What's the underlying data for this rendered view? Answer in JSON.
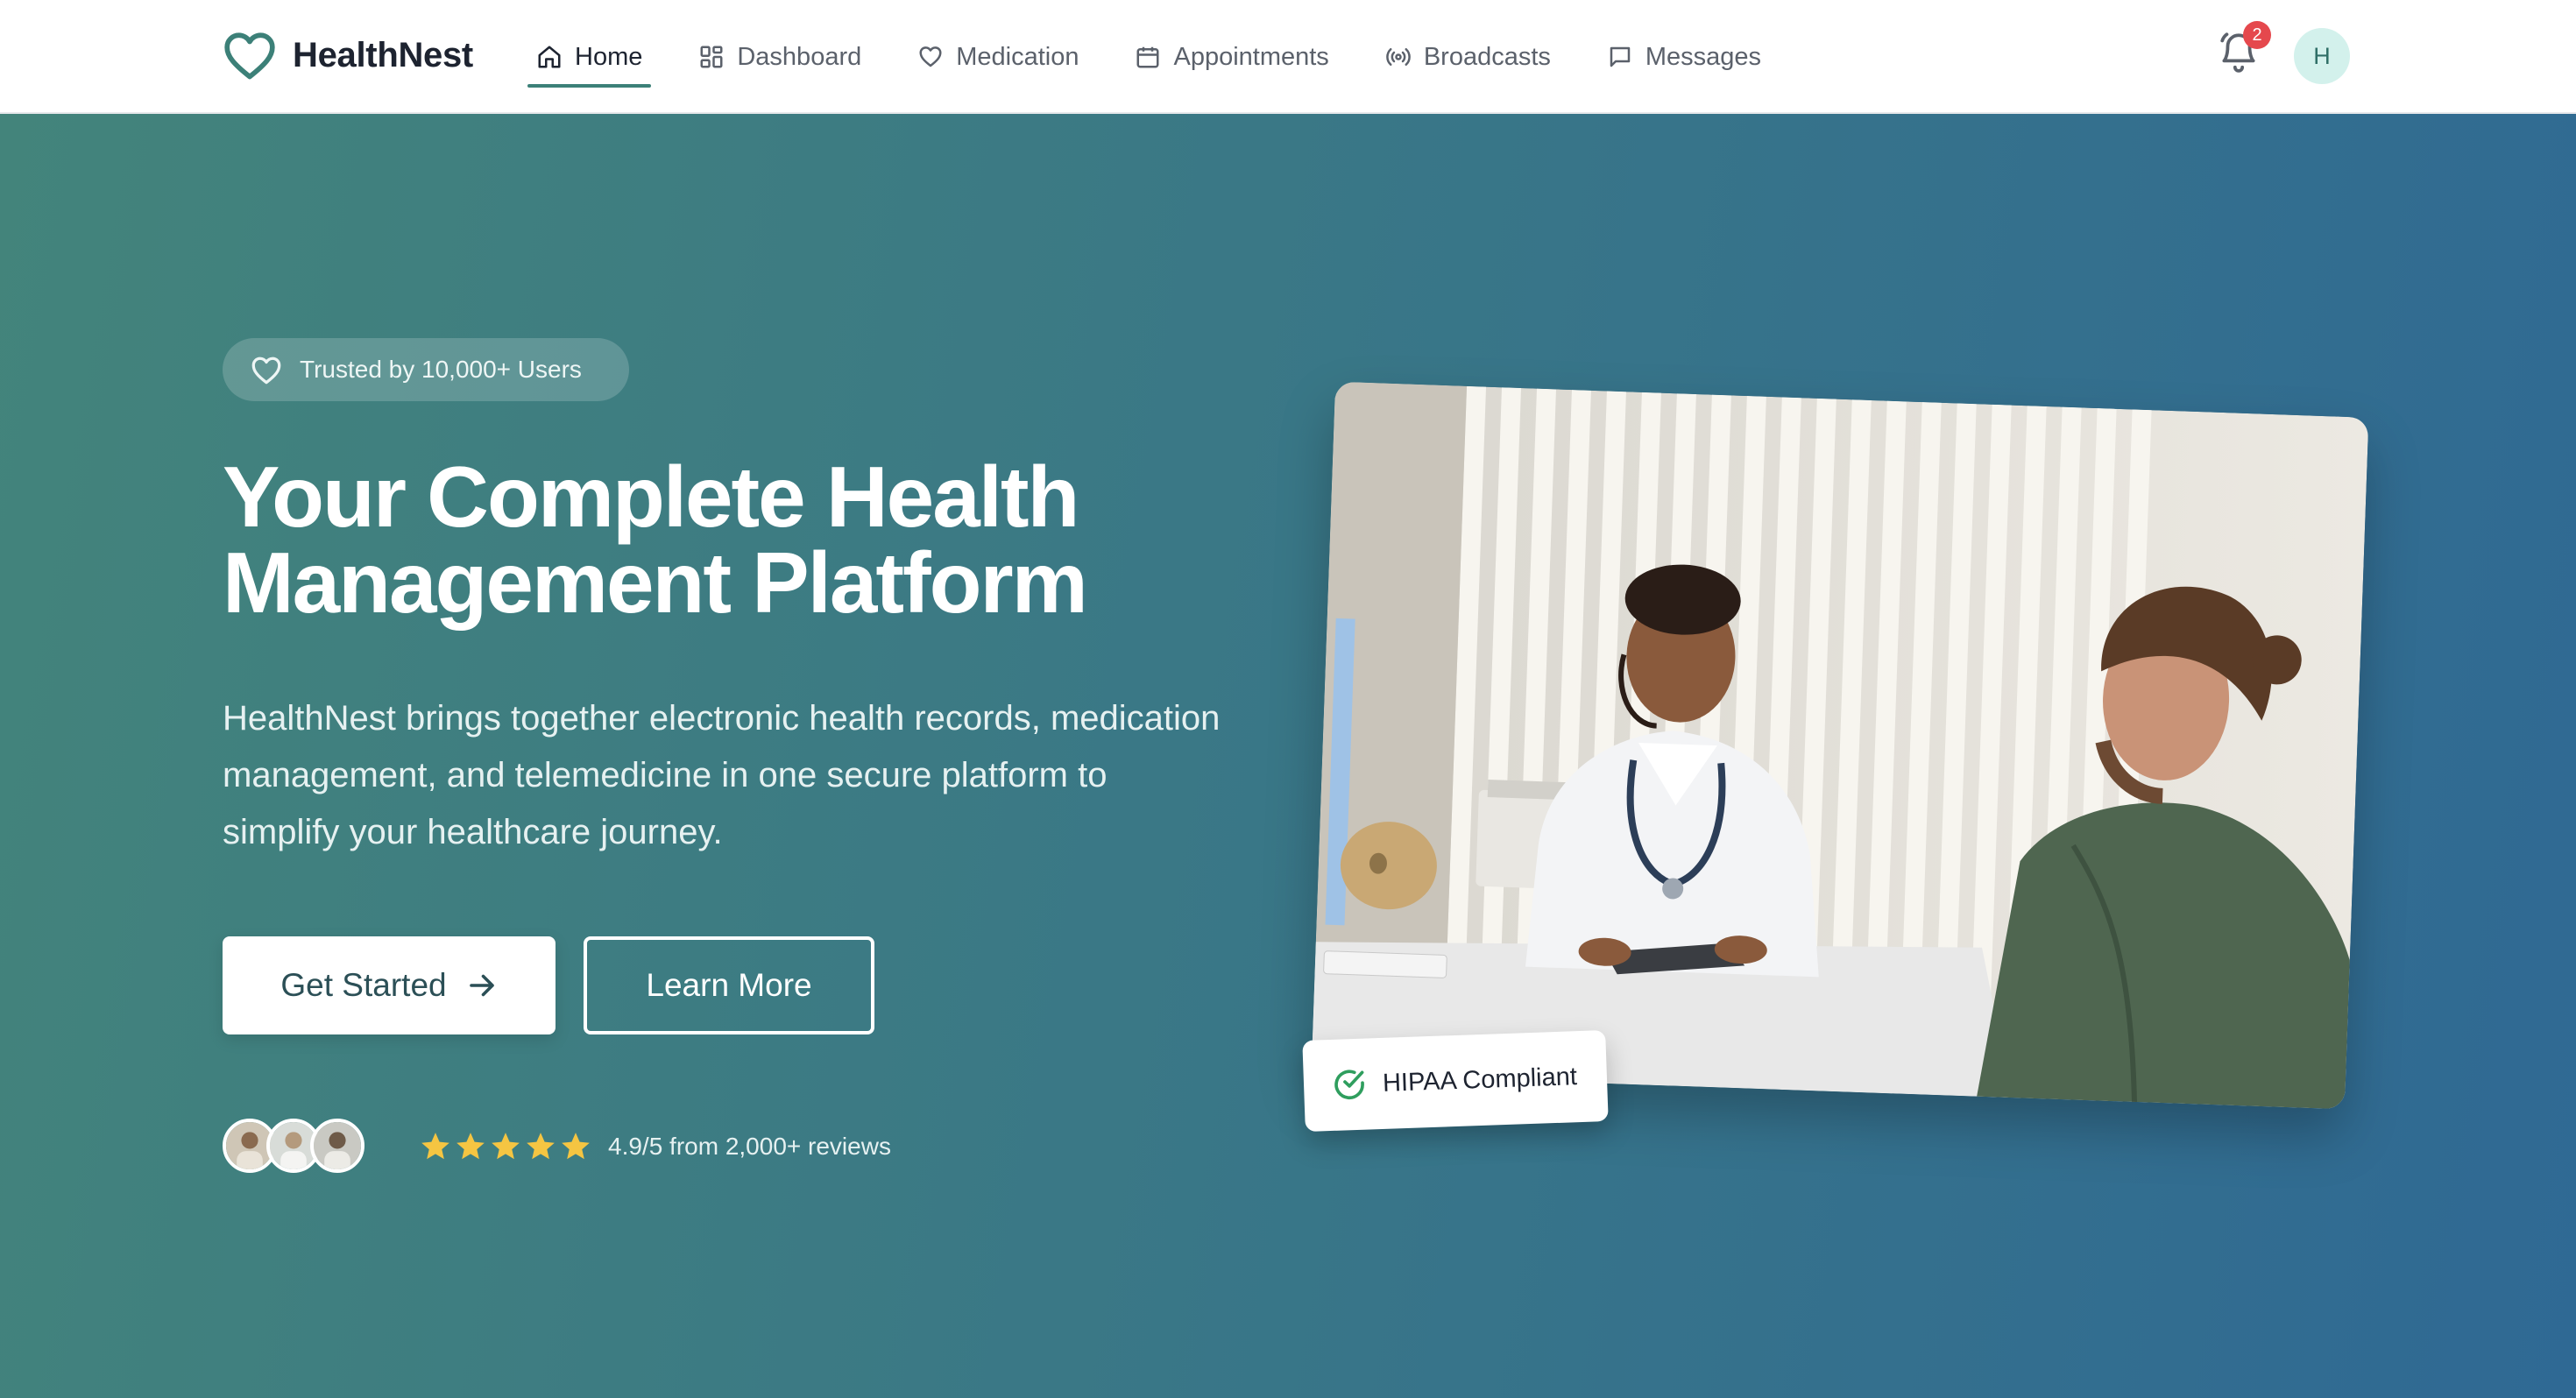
{
  "brand": {
    "name": "HealthNest"
  },
  "nav": {
    "items": [
      {
        "label": "Home",
        "icon": "home-icon",
        "active": true
      },
      {
        "label": "Dashboard",
        "icon": "dashboard-icon"
      },
      {
        "label": "Medication",
        "icon": "heart-icon"
      },
      {
        "label": "Appointments",
        "icon": "calendar-icon"
      },
      {
        "label": "Broadcasts",
        "icon": "broadcast-icon"
      },
      {
        "label": "Messages",
        "icon": "message-icon"
      }
    ]
  },
  "notifications": {
    "count": "2",
    "icon": "bell-icon"
  },
  "user": {
    "initial": "H"
  },
  "hero": {
    "badge": "Trusted by 10,000+ Users",
    "headline_line1": "Your Complete Health",
    "headline_line2": "Management Platform",
    "subtext": "HealthNest brings together electronic health records, medication management, and telemedicine in one secure platform to simplify your healthcare journey.",
    "primary_cta": "Get Started",
    "secondary_cta": "Learn More",
    "rating_text": "4.9/5 from 2,000+ reviews",
    "stars": 5,
    "compliance_badge": "HIPAA Compliant"
  },
  "colors": {
    "accent": "#3c8078",
    "hero_gradient_start": "#43847b",
    "hero_gradient_end": "#2f6994",
    "star": "#f5c542",
    "badge_red": "#e5484d"
  }
}
